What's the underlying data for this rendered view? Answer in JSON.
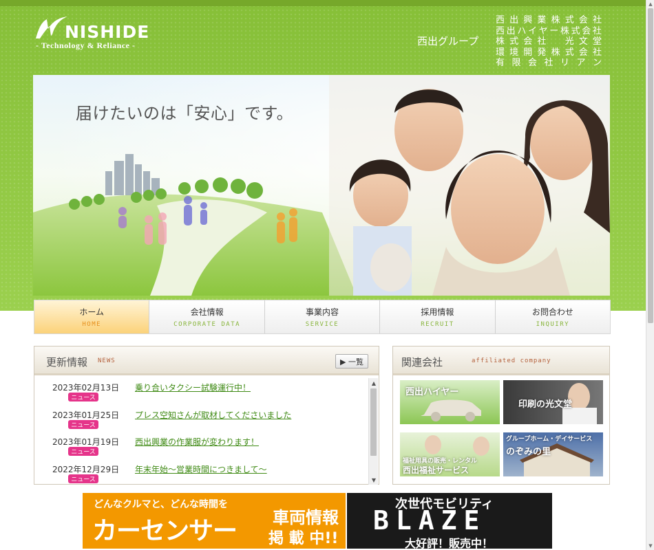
{
  "header": {
    "logo_word": "NISHIDE",
    "logo_tagline": "- Technology & Reliance -",
    "group_label": "西出グループ",
    "group_companies": [
      [
        "西",
        "出",
        "興",
        "業",
        "株",
        "式",
        "会",
        "社"
      ],
      [
        "西",
        "出",
        "ハ",
        "イ",
        "ヤ",
        "ー",
        "株",
        "式",
        "会",
        "社"
      ],
      [
        "株",
        "式",
        "会",
        "社",
        "　",
        "光",
        "文",
        "堂"
      ],
      [
        "環",
        "境",
        "開",
        "発",
        "株",
        "式",
        "会",
        "社"
      ],
      [
        "有",
        "限",
        "会",
        "社",
        "リ",
        "ア",
        "ン"
      ]
    ]
  },
  "hero": {
    "copy": "届けたいのは「安心」です。"
  },
  "nav": {
    "items": [
      {
        "jp": "ホーム",
        "en": "HOME"
      },
      {
        "jp": "会社情報",
        "en": "CORPORATE DATA"
      },
      {
        "jp": "事業内容",
        "en": "SERVICE"
      },
      {
        "jp": "採用情報",
        "en": "RECRUIT"
      },
      {
        "jp": "お問合わせ",
        "en": "INQUIRY"
      }
    ]
  },
  "news": {
    "title": "更新情報",
    "subtitle": "NEWS",
    "list_button": "▶ 一覧",
    "items": [
      {
        "date": "2023年02月13日",
        "tag": "ニュース",
        "text": "乗り合いタクシー試験運行中！"
      },
      {
        "date": "2023年01月25日",
        "tag": "ニュース",
        "text": "プレス空知さんが取材してくださいました"
      },
      {
        "date": "2023年01月19日",
        "tag": "ニュース",
        "text": "西出興業の作業服が変わります！"
      },
      {
        "date": "2022年12月29日",
        "tag": "ニュース",
        "text": "年末年始～営業時間につきまして～"
      }
    ]
  },
  "affiliates": {
    "title": "関連会社",
    "subtitle": "affiliated company",
    "cards": [
      {
        "label": "西出ハイヤー"
      },
      {
        "label": "印刷の光文堂"
      },
      {
        "label_top": "福祉用具の販売・レンタル",
        "label": "西出福祉サービス"
      },
      {
        "label_top": "グループホーム・デイサービス",
        "label": "のぞみの里"
      }
    ]
  },
  "banners": {
    "carsensor": {
      "line1": "どんなクルマと、どんな時間を",
      "main": "カーセンサー",
      "side1": "車両情報",
      "side2": "掲 載 中!!"
    },
    "blaze": {
      "line1": "次世代モビリティ",
      "main": "BLAZE",
      "line3": "大好評！販売中！"
    }
  },
  "colors": {
    "brand_green": "#8cc63e",
    "nav_active": "#fbd27a",
    "news_tag": "#e5348a",
    "link_green": "#3f8a14",
    "banner_orange": "#f39800"
  }
}
